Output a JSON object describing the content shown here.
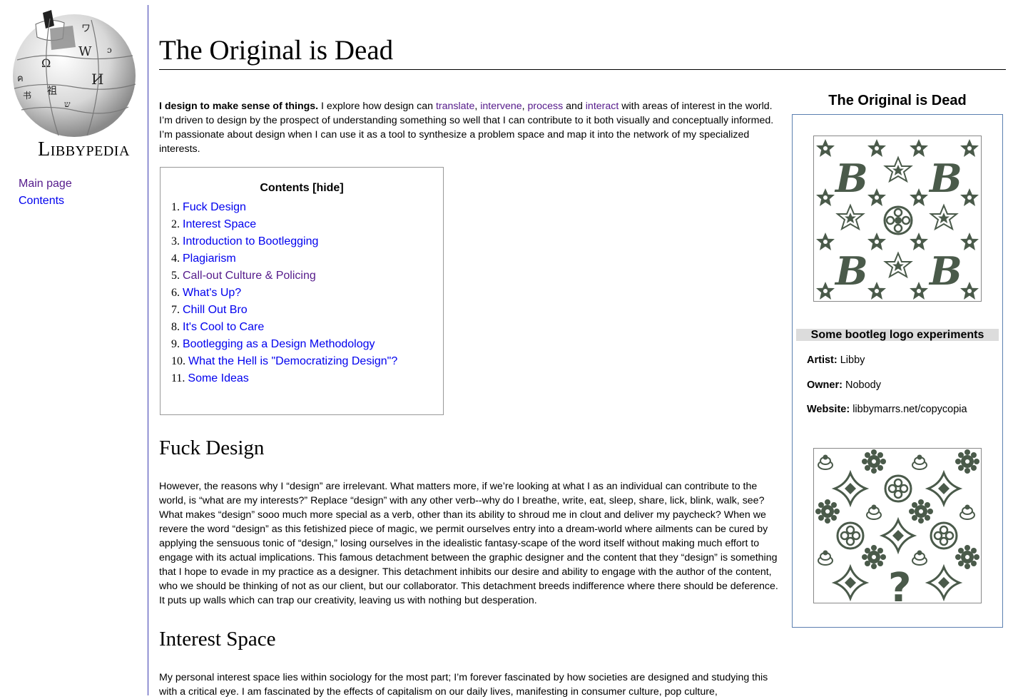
{
  "site": {
    "name": "Libbypedia",
    "logo_icon": "puzzle-globe-icon"
  },
  "nav": {
    "main_page": "Main page",
    "contents": "Contents"
  },
  "article": {
    "title": "The Original is Dead",
    "intro": {
      "lead": "I design to make sense of things.",
      "text_before": " I explore how design can ",
      "link_translate": "translate",
      "sep1": ", ",
      "link_intervene": "intervene",
      "sep2": ", ",
      "link_process": "process",
      "text_and": " and ",
      "link_interact": "interact",
      "text_after": " with areas of interest in the world. I’m driven to design by the prospect of understanding something so well that I can contribute to it both visually and conceptually informed. I’m passionate about design when I can use it as a tool to synthesize a problem space and map it into the network of my specialized interests."
    },
    "toc": {
      "title": "Contents",
      "toggle": "[hide]",
      "items": [
        {
          "num": "1.",
          "label": "Fuck Design"
        },
        {
          "num": "2.",
          "label": "Interest Space"
        },
        {
          "num": "3.",
          "label": "Introduction to Bootlegging"
        },
        {
          "num": "4.",
          "label": "Plagiarism"
        },
        {
          "num": "5.",
          "label": "Call-out Culture & Policing"
        },
        {
          "num": "6.",
          "label": "What's Up?"
        },
        {
          "num": "7.",
          "label": "Chill Out Bro"
        },
        {
          "num": "8.",
          "label": "It's Cool to Care"
        },
        {
          "num": "9.",
          "label": "Bootlegging as a Design Methodology"
        },
        {
          "num": "10.",
          "label": "What the Hell is \"Democratizing Design\"?"
        },
        {
          "num": "11.",
          "label": "Some Ideas"
        }
      ]
    },
    "sections": [
      {
        "heading": "Fuck Design",
        "text": "However, the reasons why I “design” are irrelevant. What matters more, if we’re looking at what I as an individual can contribute to the world, is “what are my interests?” Replace “design” with any other verb--why do I breathe, write, eat, sleep, share, lick, blink, walk, see? What makes “design” sooo much more special as a verb, other than its ability to shroud me in clout and deliver my paycheck? When we revere the word “design” as this fetishized piece of magic, we permit ourselves entry into a dream-world where ailments can be cured by applying the sensuous tonic of “design,” losing ourselves in the idealistic fantasy-scape of the word itself without making much effort to engage with its actual implications. This famous detachment between the graphic designer and the content that they “design” is something that I hope to evade in my practice as a designer. This detachment inhibits our desire and ability to engage with the author of the content, who we should be thinking of not as our client, but our collaborator. This detachment breeds indifference where there should be deference. It puts up walls which can trap our creativity, leaving us with nothing but desperation."
      },
      {
        "heading": "Interest Space",
        "text": "My personal interest space lies within sociology for the most part; I’m forever fascinated by how societies are designed and studying this with a critical eye. I am fascinated by the effects of capitalism on our daily lives, manifesting in consumer culture, pop culture,"
      }
    ]
  },
  "infobox": {
    "title": "The Original is Dead",
    "caption": "Some bootleg logo experiments",
    "artist_label": "Artist:",
    "artist_value": "Libby",
    "owner_label": "Owner:",
    "owner_value": "Nobody",
    "website_label": "Website:",
    "website_value": "libbymarrs.net/copycopia",
    "pattern_color": "#4a5a4a",
    "image1_letter": "B",
    "image2_glyph": "?"
  },
  "colors": {
    "link": "#0000ee",
    "visited": "#551a8b",
    "rail": "#3a3ab0",
    "infobox_border": "#5b7fb0"
  }
}
